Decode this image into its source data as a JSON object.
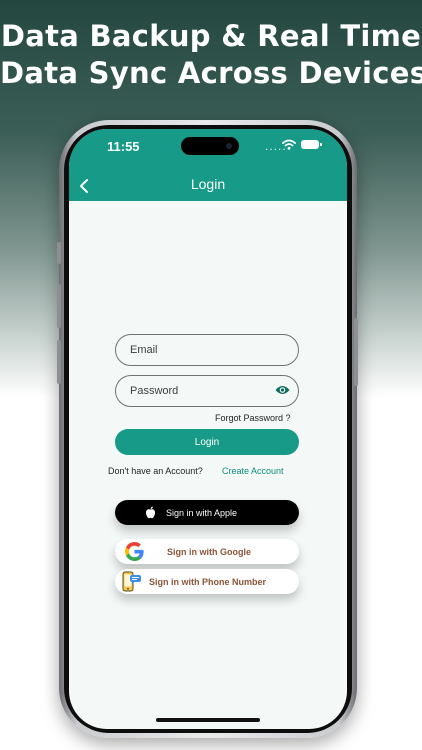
{
  "headline": {
    "line1": "Data Backup & Real Time",
    "line2": "Data Sync Across Devices"
  },
  "status_bar": {
    "time": "11:55",
    "signal": "....."
  },
  "app_bar": {
    "title": "Login",
    "back_icon": "chevron-left-icon"
  },
  "form": {
    "email_placeholder": "Email",
    "password_placeholder": "Password",
    "password_visibility_icon": "eye-icon",
    "forgot_password": "Forgot Password ?",
    "login_button": "Login",
    "no_account_text": "Don't have an Account?",
    "create_account_link": "Create Account"
  },
  "social": {
    "apple_label": "Sign in with Apple",
    "google_label": "Sign in with Google",
    "phone_label": "Sign in with Phone Number"
  },
  "colors": {
    "accent": "#179a87",
    "social_text": "#8b5438",
    "screen_bg": "#f4f9f8"
  }
}
